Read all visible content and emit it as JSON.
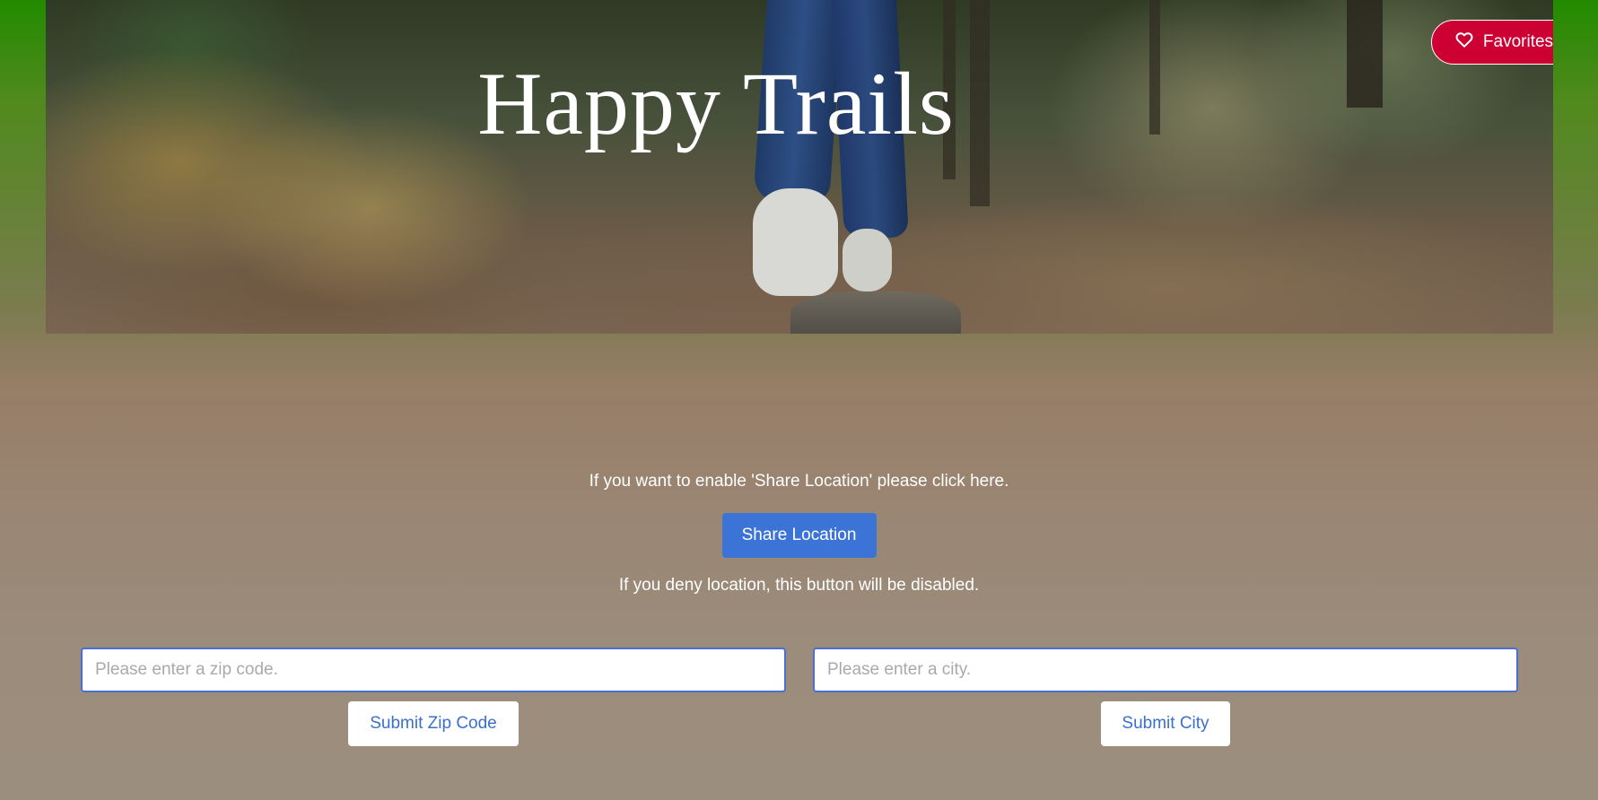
{
  "hero": {
    "title": "Happy Trails"
  },
  "header": {
    "favorites_label": "Favorites",
    "favorites_icon": "heart-icon",
    "favorites_color": "#cc0033"
  },
  "share": {
    "prompt": "If you want to enable 'Share Location' please click here.",
    "button_label": "Share Location",
    "deny_note": "If you deny location, this button will be disabled.",
    "button_color": "#3b74d6"
  },
  "search": {
    "zip_placeholder": "Please enter a zip code.",
    "city_placeholder": "Please enter a city.",
    "zip_value": "",
    "city_value": "",
    "submit_zip_label": "Submit Zip Code",
    "submit_city_label": "Submit City"
  }
}
